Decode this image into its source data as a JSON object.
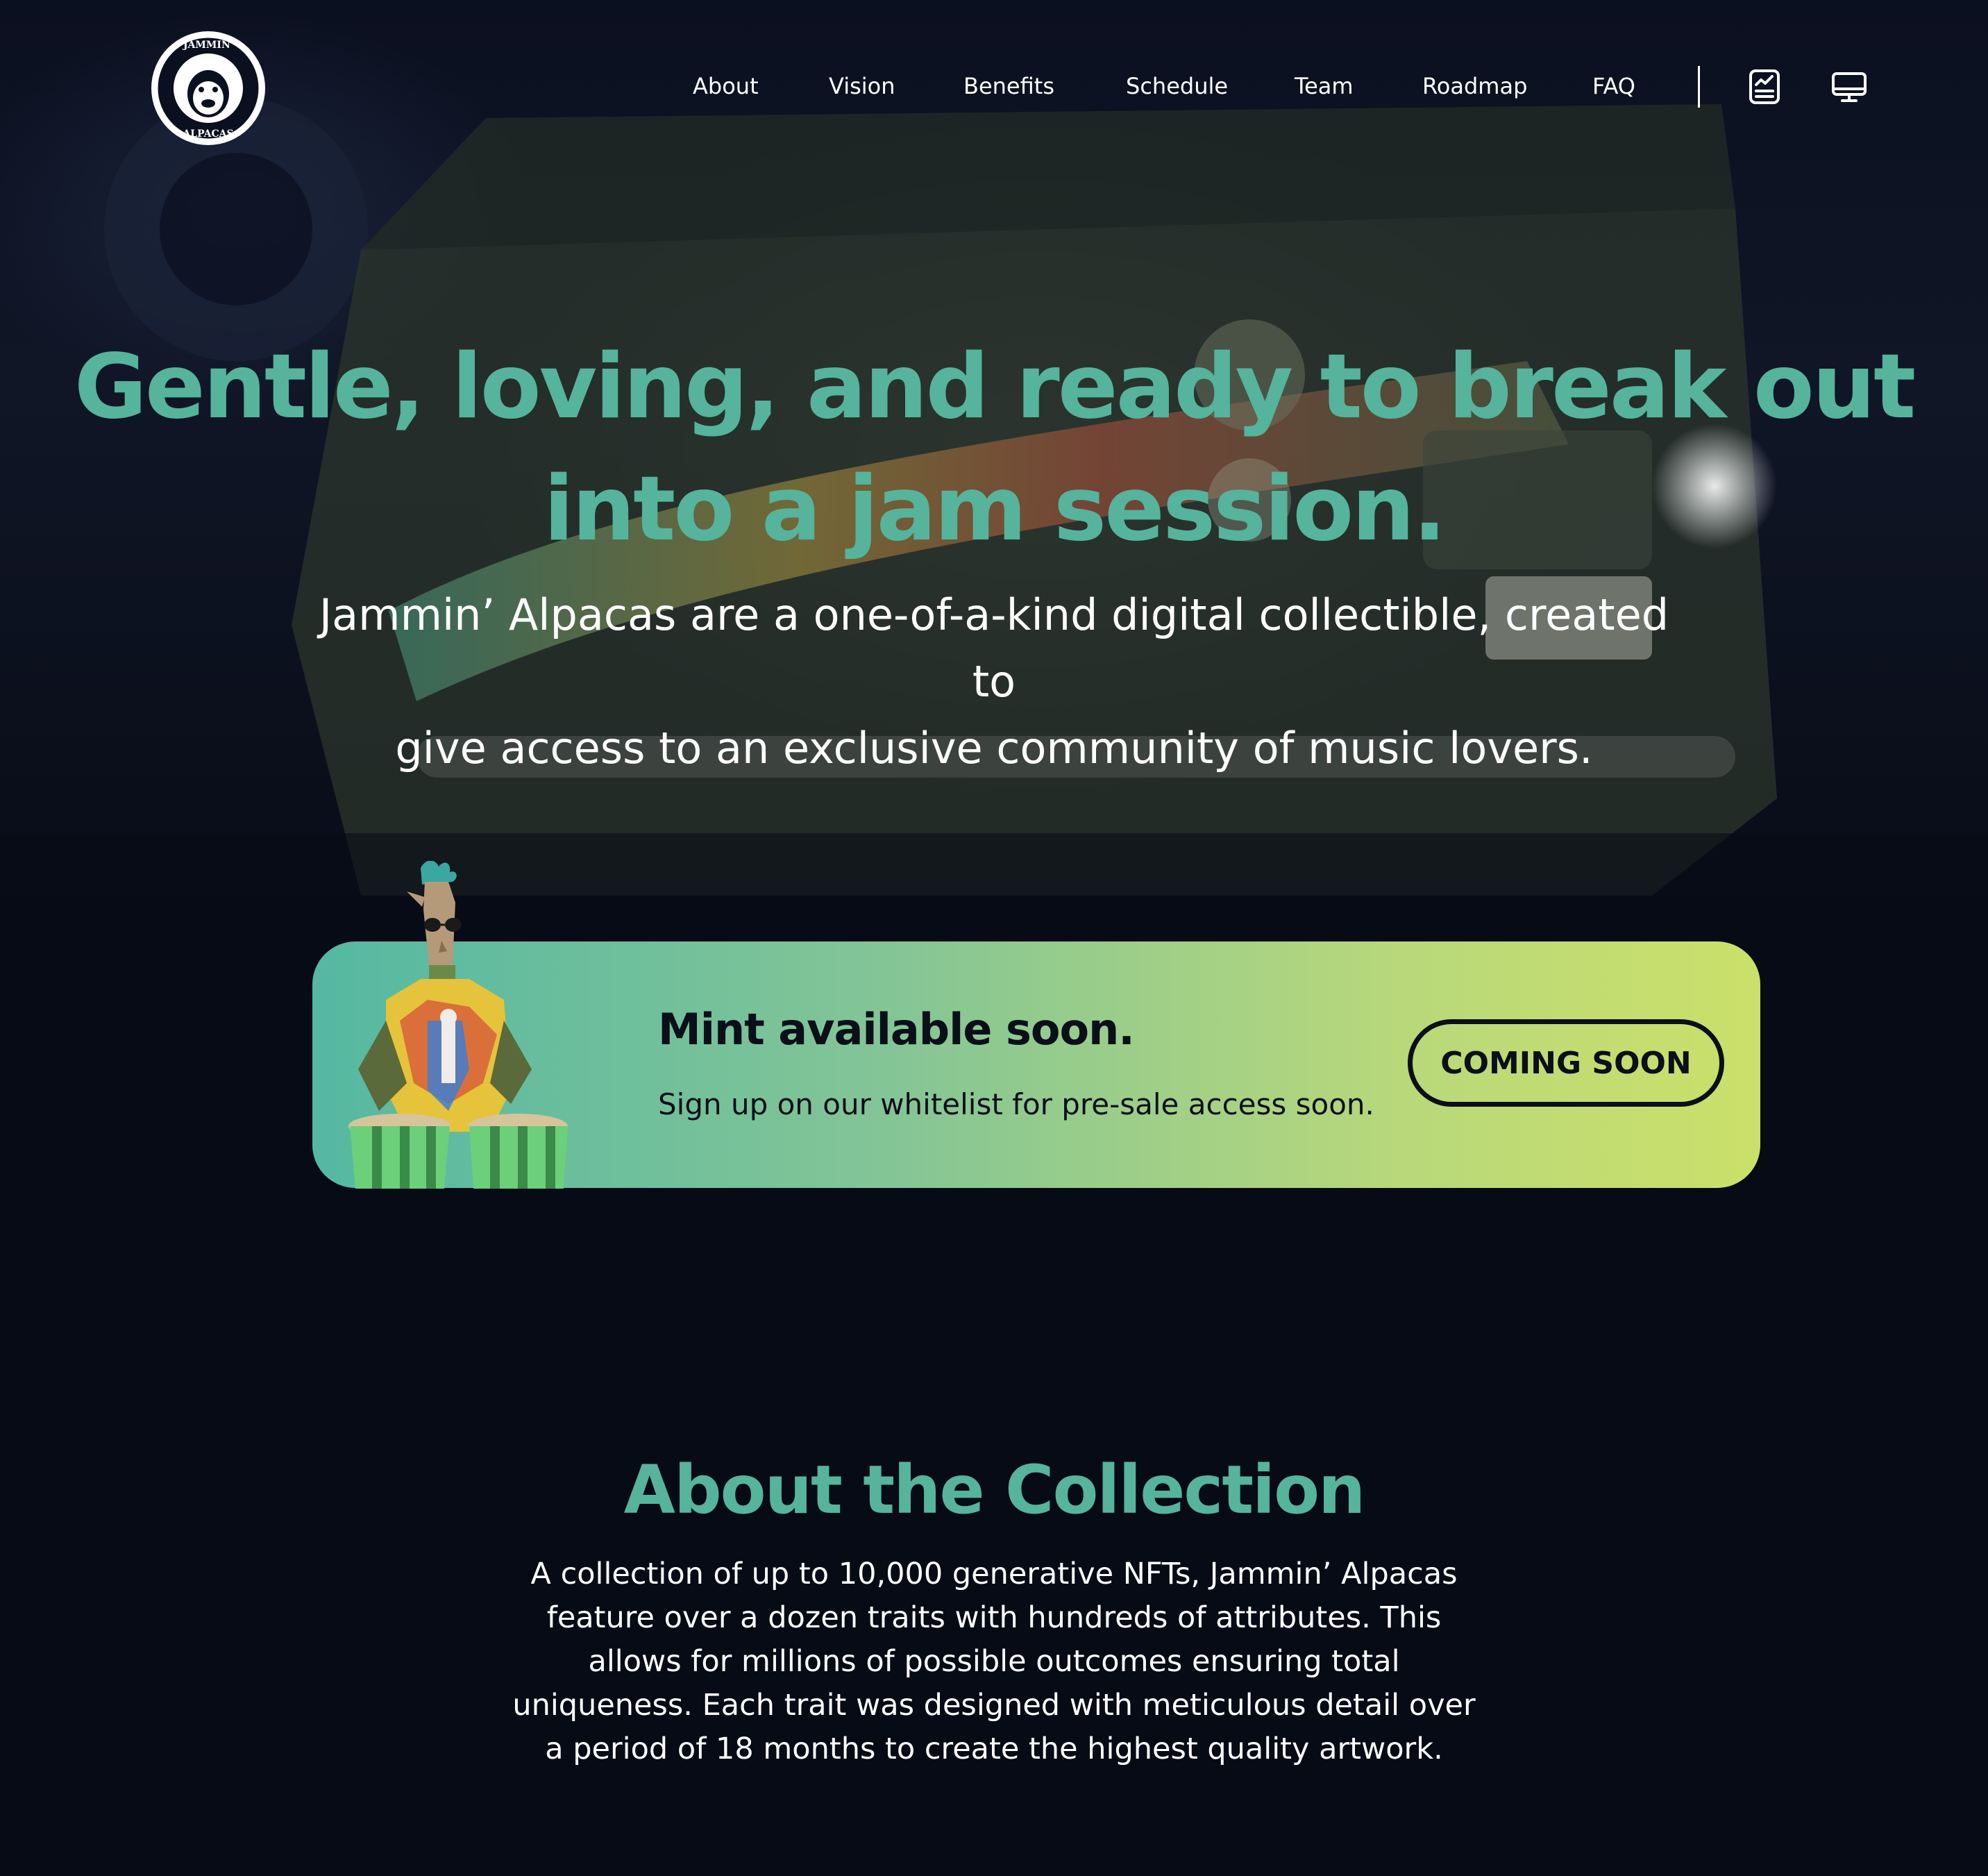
{
  "brand": {
    "logo_alt": "Jammin' Alpacas",
    "logo_top_text": "JAMMIN'",
    "logo_bottom_text": "ALPACAS"
  },
  "nav": {
    "items": [
      {
        "label": "About"
      },
      {
        "label": "Vision"
      },
      {
        "label": "Benefits"
      },
      {
        "label": "Schedule"
      },
      {
        "label": "Team"
      },
      {
        "label": "Roadmap"
      },
      {
        "label": "FAQ"
      }
    ],
    "icons": [
      "whitepaper-chart-icon",
      "desktop-app-icon"
    ]
  },
  "hero": {
    "title_line1": "Gentle, loving, and ready to break out",
    "title_line2": "into a jam session.",
    "subtitle_line1": "Jammin’ Alpacas are a one-of-a-kind digital collectible, created to",
    "subtitle_line2": "give access to an exclusive community of music lovers."
  },
  "mint": {
    "title": "Mint available soon.",
    "text": "Sign up on our whitelist for pre-sale access soon.",
    "button_label": "COMING SOON"
  },
  "about": {
    "title": "About the Collection",
    "text": "A collection of up to 10,000 generative NFTs, Jammin’ Alpacas feature over a dozen traits with hundreds of attributes. This allows for millions of possible outcomes ensuring total uniqueness. Each trait was designed with meticulous detail over a period of 18 months to create the highest quality artwork."
  },
  "colors": {
    "background": "#070b16",
    "accent_teal": "#55b49b",
    "card_gradient_start": "#55b8a2",
    "card_gradient_end": "#cbe06a",
    "dark_text": "#0a0f1a"
  }
}
